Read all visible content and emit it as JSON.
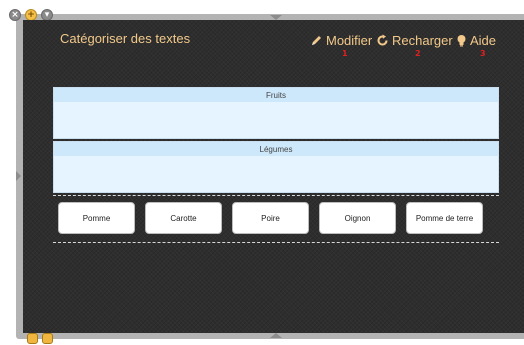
{
  "app": {
    "title": "Catégoriser des textes"
  },
  "toolbar": {
    "items": [
      {
        "label": "Modifier",
        "icon": "pencil-icon",
        "number": "1"
      },
      {
        "label": "Recharger",
        "icon": "reload-icon",
        "number": "2"
      },
      {
        "label": "Aide",
        "icon": "lightbulb-icon",
        "number": "3"
      }
    ]
  },
  "categories": [
    {
      "label": "Fruits"
    },
    {
      "label": "Légumes"
    }
  ],
  "tiles": [
    {
      "label": "Pomme"
    },
    {
      "label": "Carotte"
    },
    {
      "label": "Poire"
    },
    {
      "label": "Oignon"
    },
    {
      "label": "Pomme de terre"
    }
  ],
  "colors": {
    "panel": "#2e2e2e",
    "accent_text": "#f2c98a",
    "badge_number": "#e02020",
    "category_bg": "#e6f4ff",
    "category_header": "#cde8fb"
  }
}
